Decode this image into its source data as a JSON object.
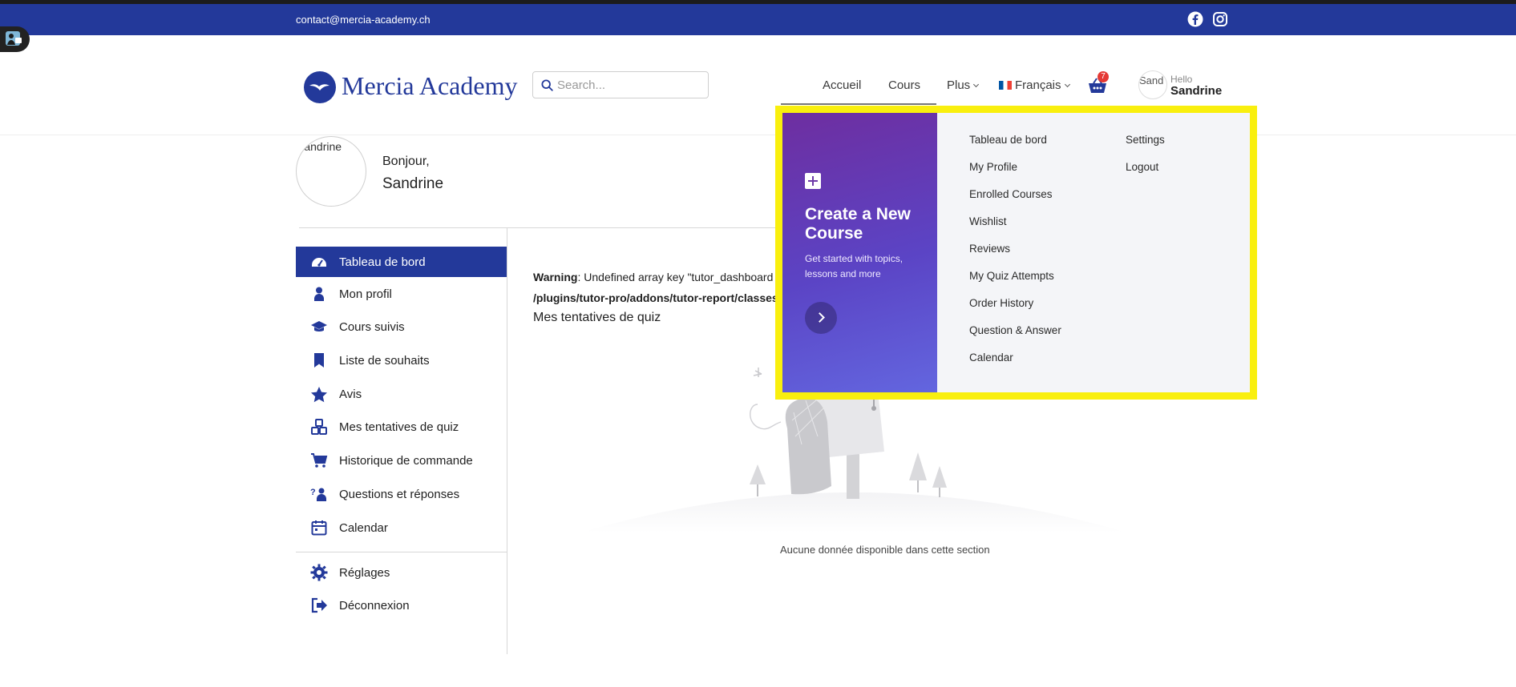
{
  "topbar": {
    "email": "contact@mercia-academy.ch",
    "social_icons": [
      "facebook-icon",
      "instagram-icon"
    ],
    "color": "#23399a"
  },
  "header": {
    "logo_text": "Mercia Academy",
    "search_placeholder": "Search...",
    "nav": {
      "accueil": "Accueil",
      "cours": "Cours",
      "plus": "Plus",
      "language": "Français"
    },
    "cart_count": "7",
    "user": {
      "avatar_text": "Sand",
      "hello": "Hello",
      "name": "Sandrine"
    }
  },
  "profile": {
    "avatar_text": "Sandrine",
    "greeting": "Bonjour,",
    "name": "Sandrine"
  },
  "sidebar": {
    "items": [
      {
        "label": "Tableau de bord",
        "icon": "dashboard-icon",
        "active": true
      },
      {
        "label": "Mon profil",
        "icon": "user-icon"
      },
      {
        "label": "Cours suivis",
        "icon": "graduation-cap-icon"
      },
      {
        "label": "Liste de souhaits",
        "icon": "bookmark-icon"
      },
      {
        "label": "Avis",
        "icon": "star-icon"
      },
      {
        "label": "Mes tentatives de quiz",
        "icon": "quiz-blocks-icon"
      },
      {
        "label": "Historique de commande",
        "icon": "cart-icon"
      },
      {
        "label": "Questions et réponses",
        "icon": "question-answer-icon"
      },
      {
        "label": "Calendar",
        "icon": "calendar-icon"
      }
    ],
    "bottom_items": [
      {
        "label": "Réglages",
        "icon": "gear-icon"
      },
      {
        "label": "Déconnexion",
        "icon": "logout-icon"
      }
    ]
  },
  "content": {
    "warning_label": "Warning",
    "warning_text": ": Undefined array key \"tutor_dashboard",
    "warning_path": "/plugins/tutor-pro/addons/tutor-report/classes",
    "title": "Mes tentatives de quiz",
    "empty_message": "Aucune donnée disponible dans cette section"
  },
  "dropdown": {
    "card_title": "Create a New Course",
    "card_subtitle": "Get started with topics, lessons and more",
    "col1": [
      "Tableau de bord",
      "My Profile",
      "Enrolled Courses",
      "Wishlist",
      "Reviews",
      "My Quiz Attempts",
      "Order History",
      "Question & Answer",
      "Calendar"
    ],
    "col2": [
      "Settings",
      "Logout"
    ],
    "highlight_color": "#f9ef0e"
  }
}
